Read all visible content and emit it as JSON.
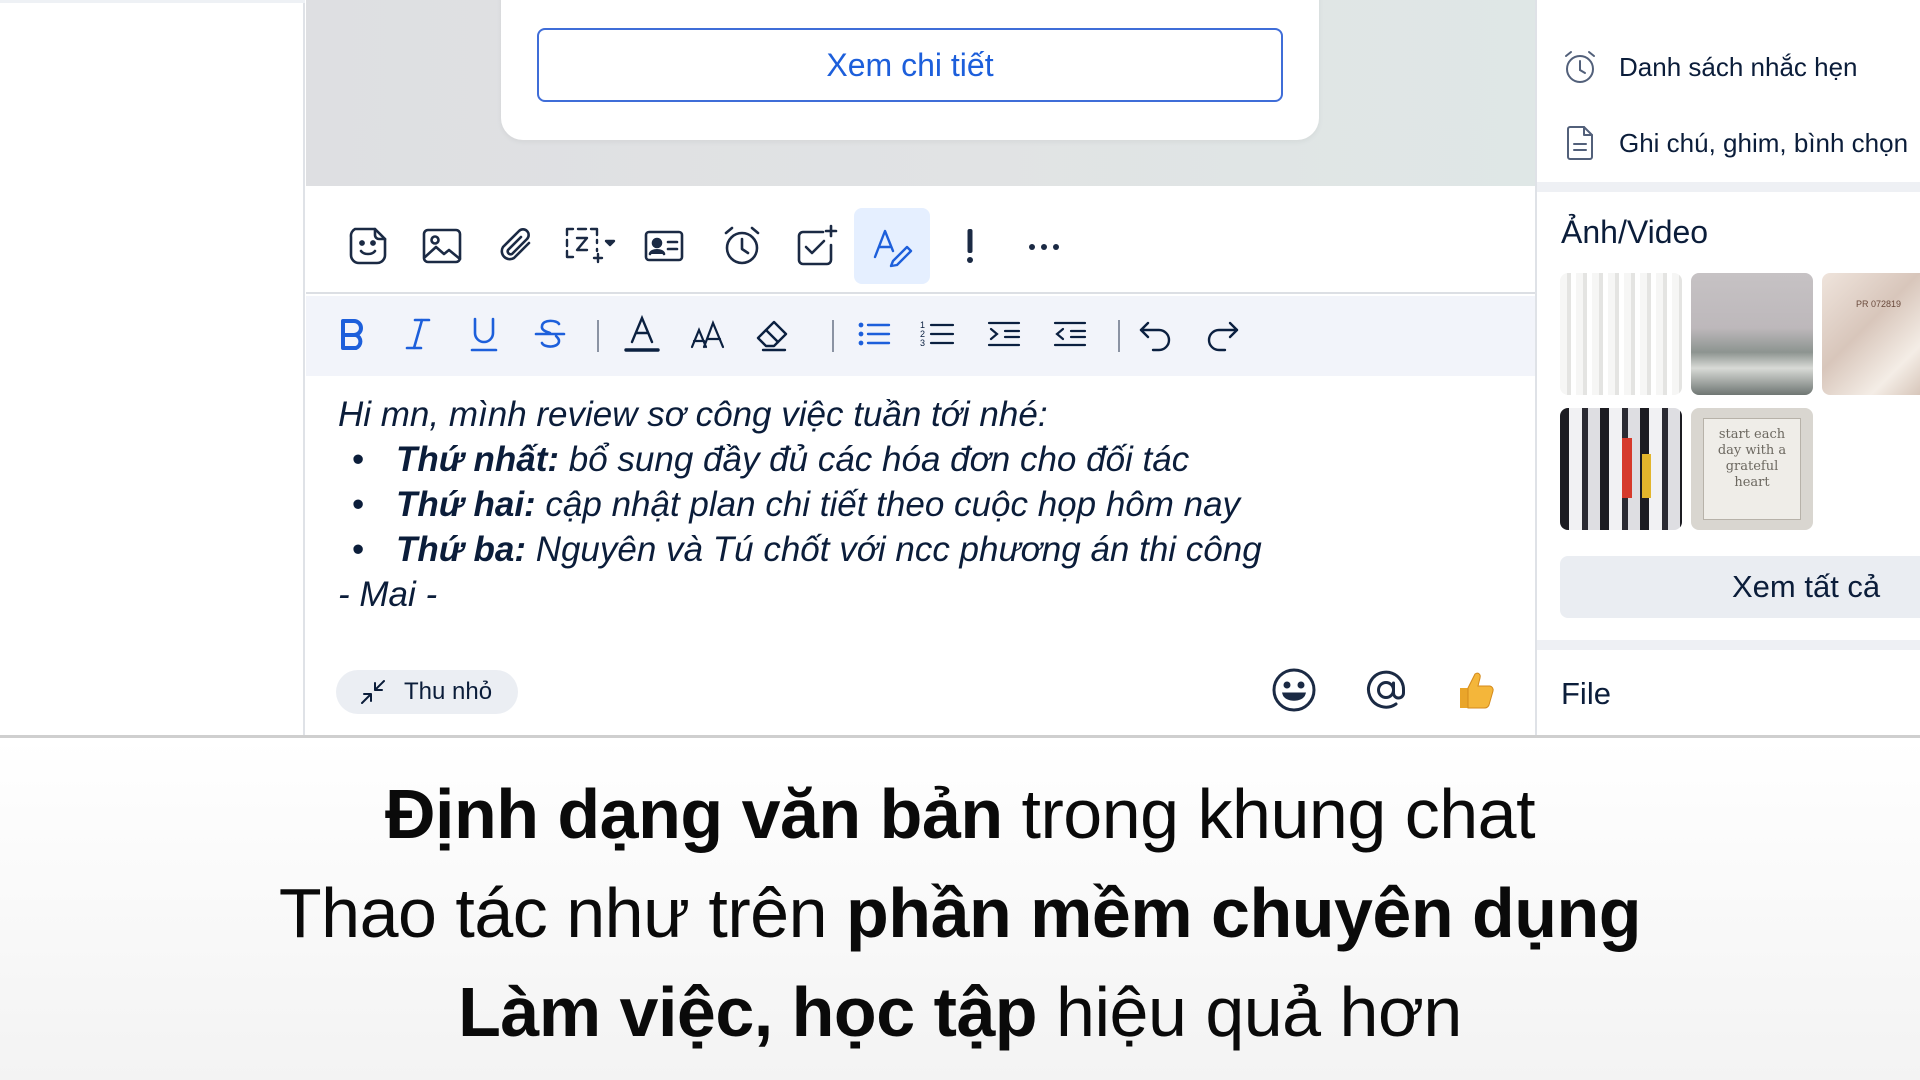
{
  "message_card": {
    "detail_button": "Xem chi tiết"
  },
  "editor": {
    "intro": "Hi mn, mình review sơ công việc tuần tới nhé:",
    "items": [
      {
        "label": "Thứ nhất:",
        "text": " bổ sung đầy đủ các hóa đơn cho đối tác"
      },
      {
        "label": "Thứ hai:",
        "text": " cập nhật plan chi tiết theo cuộc họp hôm nay"
      },
      {
        "label": "Thứ ba:",
        "text": " Nguyên và Tú chốt với ncc phương án thi công"
      }
    ],
    "signature": "- Mai -"
  },
  "composer": {
    "shrink_label": "Thu nhỏ"
  },
  "right_panel": {
    "reminders": "Danh sách nhắc hẹn",
    "notes": "Ghi chú, ghim, bình chọn",
    "media_title": "Ảnh/Video",
    "see_all": "Xem tất cả",
    "file_title": "File",
    "thumb_text": "start each day with a grateful heart",
    "thumb_tag": "PR 072819"
  },
  "caption": {
    "line1_bold": "Định dạng văn bản",
    "line1_rest": " trong khung chat",
    "line2_rest": "Thao tác như trên ",
    "line2_bold": "phần mềm chuyên dụng",
    "line3_bold": "Làm việc, học tập",
    "line3_rest": " hiệu quả hơn"
  },
  "colors": {
    "accent": "#1d5fdb",
    "active_bg": "#e5efff",
    "text": "#0b1d3a",
    "thumbs_up": "#f4b63a"
  }
}
